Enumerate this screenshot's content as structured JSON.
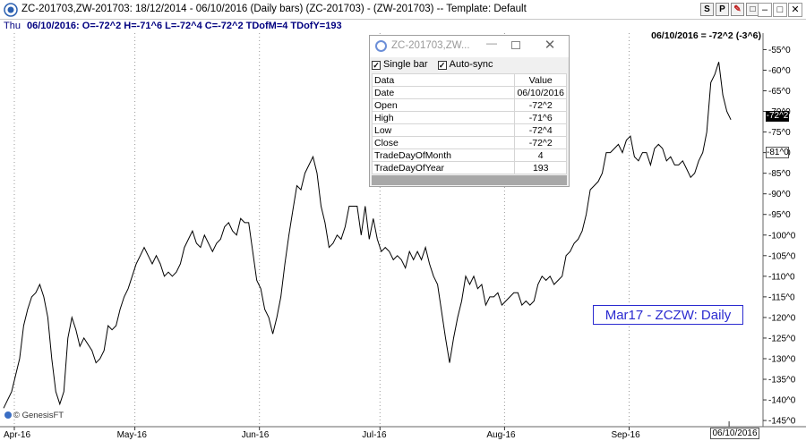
{
  "window": {
    "title": "ZC-201703,ZW-201703:  18/12/2014 - 06/10/2016  (Daily bars)   (ZC-201703) - (ZW-201703)  --  Template: Default",
    "buttons": [
      "S",
      "P",
      "✎",
      "□"
    ],
    "controls": [
      "–",
      "□",
      "✕"
    ]
  },
  "info_bar": {
    "day": "Thu",
    "values": "06/10/2016:  O=-72^2  H=-71^6  L=-72^4  C=-72^2  TDofM=4  TDofY=193"
  },
  "right_header": "06/10/2016 = -72^2 (-3^6)",
  "current_value_tag": "-72^2",
  "cursor_value_tag": "-81^0",
  "date_tag": "06/10/2016",
  "watermark": "© GenesisFT",
  "chart_label": "Mar17 - ZCZW:  Daily",
  "popup": {
    "title": "ZC-201703,ZW...",
    "single_bar": "Single bar",
    "auto_sync": "Auto-sync",
    "headers": [
      "Data",
      "Value"
    ],
    "rows": [
      [
        "Date",
        "06/10/2016"
      ],
      [
        "Open",
        "-72^2"
      ],
      [
        "High",
        "-71^6"
      ],
      [
        "Low",
        "-72^4"
      ],
      [
        "Close",
        "-72^2"
      ],
      [
        "TradeDayOfMonth",
        "4"
      ],
      [
        "TradeDayOfYear",
        "193"
      ]
    ]
  },
  "colors": {
    "line": "#000000",
    "grid": "#999999",
    "label": "#2b2bd0",
    "info": "#000080"
  },
  "chart_data": {
    "type": "line",
    "y_ticks": [
      "-55^0",
      "-60^0",
      "-65^0",
      "-70^0",
      "-75^0",
      "-80^0",
      "-85^0",
      "-90^0",
      "-95^0",
      "-100^0",
      "-105^0",
      "-110^0",
      "-115^0",
      "-120^0",
      "-125^0",
      "-130^0",
      "-135^0",
      "-140^0",
      "-145^0"
    ],
    "y_tick_values": [
      -55,
      -60,
      -65,
      -70,
      -75,
      -80,
      -85,
      -90,
      -95,
      -100,
      -105,
      -110,
      -115,
      -120,
      -125,
      -130,
      -135,
      -140,
      -145
    ],
    "ylim": [
      -146.5,
      -51
    ],
    "x_ticks": [
      "Apr-16",
      "May-16",
      "Jun-16",
      "Jul-16",
      "Aug-16",
      "Sep-16"
    ],
    "x_tick_days": [
      0,
      30,
      61,
      91,
      122,
      153
    ],
    "xlim": [
      0,
      189
    ],
    "x_unit": "days from 01/04/2016",
    "points": [
      [
        0,
        -142
      ],
      [
        2,
        -138
      ],
      [
        4,
        -130
      ],
      [
        5,
        -122
      ],
      [
        6,
        -118
      ],
      [
        7,
        -115
      ],
      [
        8,
        -114
      ],
      [
        9,
        -112
      ],
      [
        10,
        -115
      ],
      [
        11,
        -120
      ],
      [
        12,
        -130
      ],
      [
        13,
        -138
      ],
      [
        14,
        -141
      ],
      [
        15,
        -138
      ],
      [
        16,
        -125
      ],
      [
        17,
        -120
      ],
      [
        18,
        -123
      ],
      [
        19,
        -127
      ],
      [
        20,
        -125
      ],
      [
        22,
        -128
      ],
      [
        23,
        -131
      ],
      [
        24,
        -130
      ],
      [
        25,
        -128
      ],
      [
        26,
        -122
      ],
      [
        27,
        -123
      ],
      [
        28,
        -122
      ],
      [
        29,
        -118
      ],
      [
        30,
        -115
      ],
      [
        31,
        -113
      ],
      [
        32,
        -110
      ],
      [
        33,
        -107
      ],
      [
        34,
        -105
      ],
      [
        35,
        -103
      ],
      [
        36,
        -105
      ],
      [
        37,
        -107
      ],
      [
        38,
        -105
      ],
      [
        39,
        -107
      ],
      [
        40,
        -110
      ],
      [
        41,
        -109
      ],
      [
        42,
        -110
      ],
      [
        43,
        -109
      ],
      [
        44,
        -107
      ],
      [
        45,
        -103
      ],
      [
        46,
        -101
      ],
      [
        47,
        -99
      ],
      [
        48,
        -102
      ],
      [
        49,
        -103
      ],
      [
        50,
        -100
      ],
      [
        52,
        -104
      ],
      [
        53,
        -102
      ],
      [
        54,
        -101
      ],
      [
        55,
        -98
      ],
      [
        56,
        -97
      ],
      [
        57,
        -99
      ],
      [
        58,
        -100
      ],
      [
        59,
        -96
      ],
      [
        60,
        -97
      ],
      [
        61,
        -97
      ],
      [
        62,
        -104
      ],
      [
        63,
        -111
      ],
      [
        64,
        -113
      ],
      [
        65,
        -118
      ],
      [
        66,
        -120
      ],
      [
        67,
        -124
      ],
      [
        68,
        -120
      ],
      [
        69,
        -115
      ],
      [
        70,
        -107
      ],
      [
        71,
        -100
      ],
      [
        72,
        -94
      ],
      [
        73,
        -88
      ],
      [
        74,
        -89
      ],
      [
        75,
        -85
      ],
      [
        76,
        -83
      ],
      [
        77,
        -81
      ],
      [
        78,
        -85
      ],
      [
        79,
        -93
      ],
      [
        80,
        -97
      ],
      [
        81,
        -103
      ],
      [
        82,
        -102
      ],
      [
        83,
        -100
      ],
      [
        84,
        -101
      ],
      [
        85,
        -98
      ],
      [
        86,
        -93
      ],
      [
        87,
        -93
      ],
      [
        88,
        -93
      ],
      [
        89,
        -100
      ],
      [
        90,
        -93
      ],
      [
        91,
        -101
      ],
      [
        92,
        -96
      ],
      [
        93,
        -101
      ],
      [
        94,
        -104
      ],
      [
        95,
        -103
      ],
      [
        96,
        -104
      ],
      [
        97,
        -106
      ],
      [
        98,
        -105
      ],
      [
        99,
        -106
      ],
      [
        100,
        -108
      ],
      [
        101,
        -104
      ],
      [
        102,
        -106
      ],
      [
        103,
        -104
      ],
      [
        104,
        -106
      ],
      [
        105,
        -103
      ],
      [
        106,
        -107
      ],
      [
        107,
        -110
      ],
      [
        108,
        -112
      ],
      [
        110,
        -125
      ],
      [
        111,
        -131
      ],
      [
        112,
        -125
      ],
      [
        113,
        -120
      ],
      [
        114,
        -116
      ],
      [
        115,
        -110
      ],
      [
        116,
        -112
      ],
      [
        117,
        -110
      ],
      [
        118,
        -113
      ],
      [
        119,
        -112
      ],
      [
        120,
        -117
      ],
      [
        121,
        -115
      ],
      [
        122,
        -115
      ],
      [
        123,
        -114
      ],
      [
        124,
        -117
      ],
      [
        125,
        -116
      ],
      [
        126,
        -115
      ],
      [
        127,
        -114
      ],
      [
        128,
        -114
      ],
      [
        129,
        -117
      ],
      [
        130,
        -116
      ],
      [
        131,
        -117
      ],
      [
        132,
        -116
      ],
      [
        133,
        -112
      ],
      [
        134,
        -110
      ],
      [
        135,
        -111
      ],
      [
        136,
        -110
      ],
      [
        137,
        -112
      ],
      [
        138,
        -111
      ],
      [
        139,
        -110
      ],
      [
        140,
        -105
      ],
      [
        141,
        -104
      ],
      [
        142,
        -102
      ],
      [
        143,
        -101
      ],
      [
        144,
        -99
      ],
      [
        145,
        -95
      ],
      [
        146,
        -89
      ],
      [
        147,
        -88
      ],
      [
        148,
        -87
      ],
      [
        149,
        -85
      ],
      [
        150,
        -80
      ],
      [
        151,
        -80
      ],
      [
        152,
        -79
      ],
      [
        153,
        -78
      ],
      [
        154,
        -80
      ],
      [
        155,
        -77
      ],
      [
        156,
        -76
      ],
      [
        157,
        -81
      ],
      [
        158,
        -82
      ],
      [
        159,
        -80
      ],
      [
        160,
        -80
      ],
      [
        161,
        -83
      ],
      [
        162,
        -79
      ],
      [
        163,
        -78
      ],
      [
        164,
        -79
      ],
      [
        165,
        -82
      ],
      [
        166,
        -81
      ],
      [
        167,
        -83
      ],
      [
        168,
        -83
      ],
      [
        169,
        -82
      ],
      [
        170,
        -84
      ],
      [
        171,
        -86
      ],
      [
        172,
        -85
      ],
      [
        173,
        -82
      ],
      [
        174,
        -80
      ],
      [
        175,
        -75
      ],
      [
        176,
        -63
      ],
      [
        177,
        -61
      ],
      [
        178,
        -58
      ],
      [
        179,
        -66
      ],
      [
        180,
        -70
      ],
      [
        181,
        -72
      ]
    ]
  }
}
